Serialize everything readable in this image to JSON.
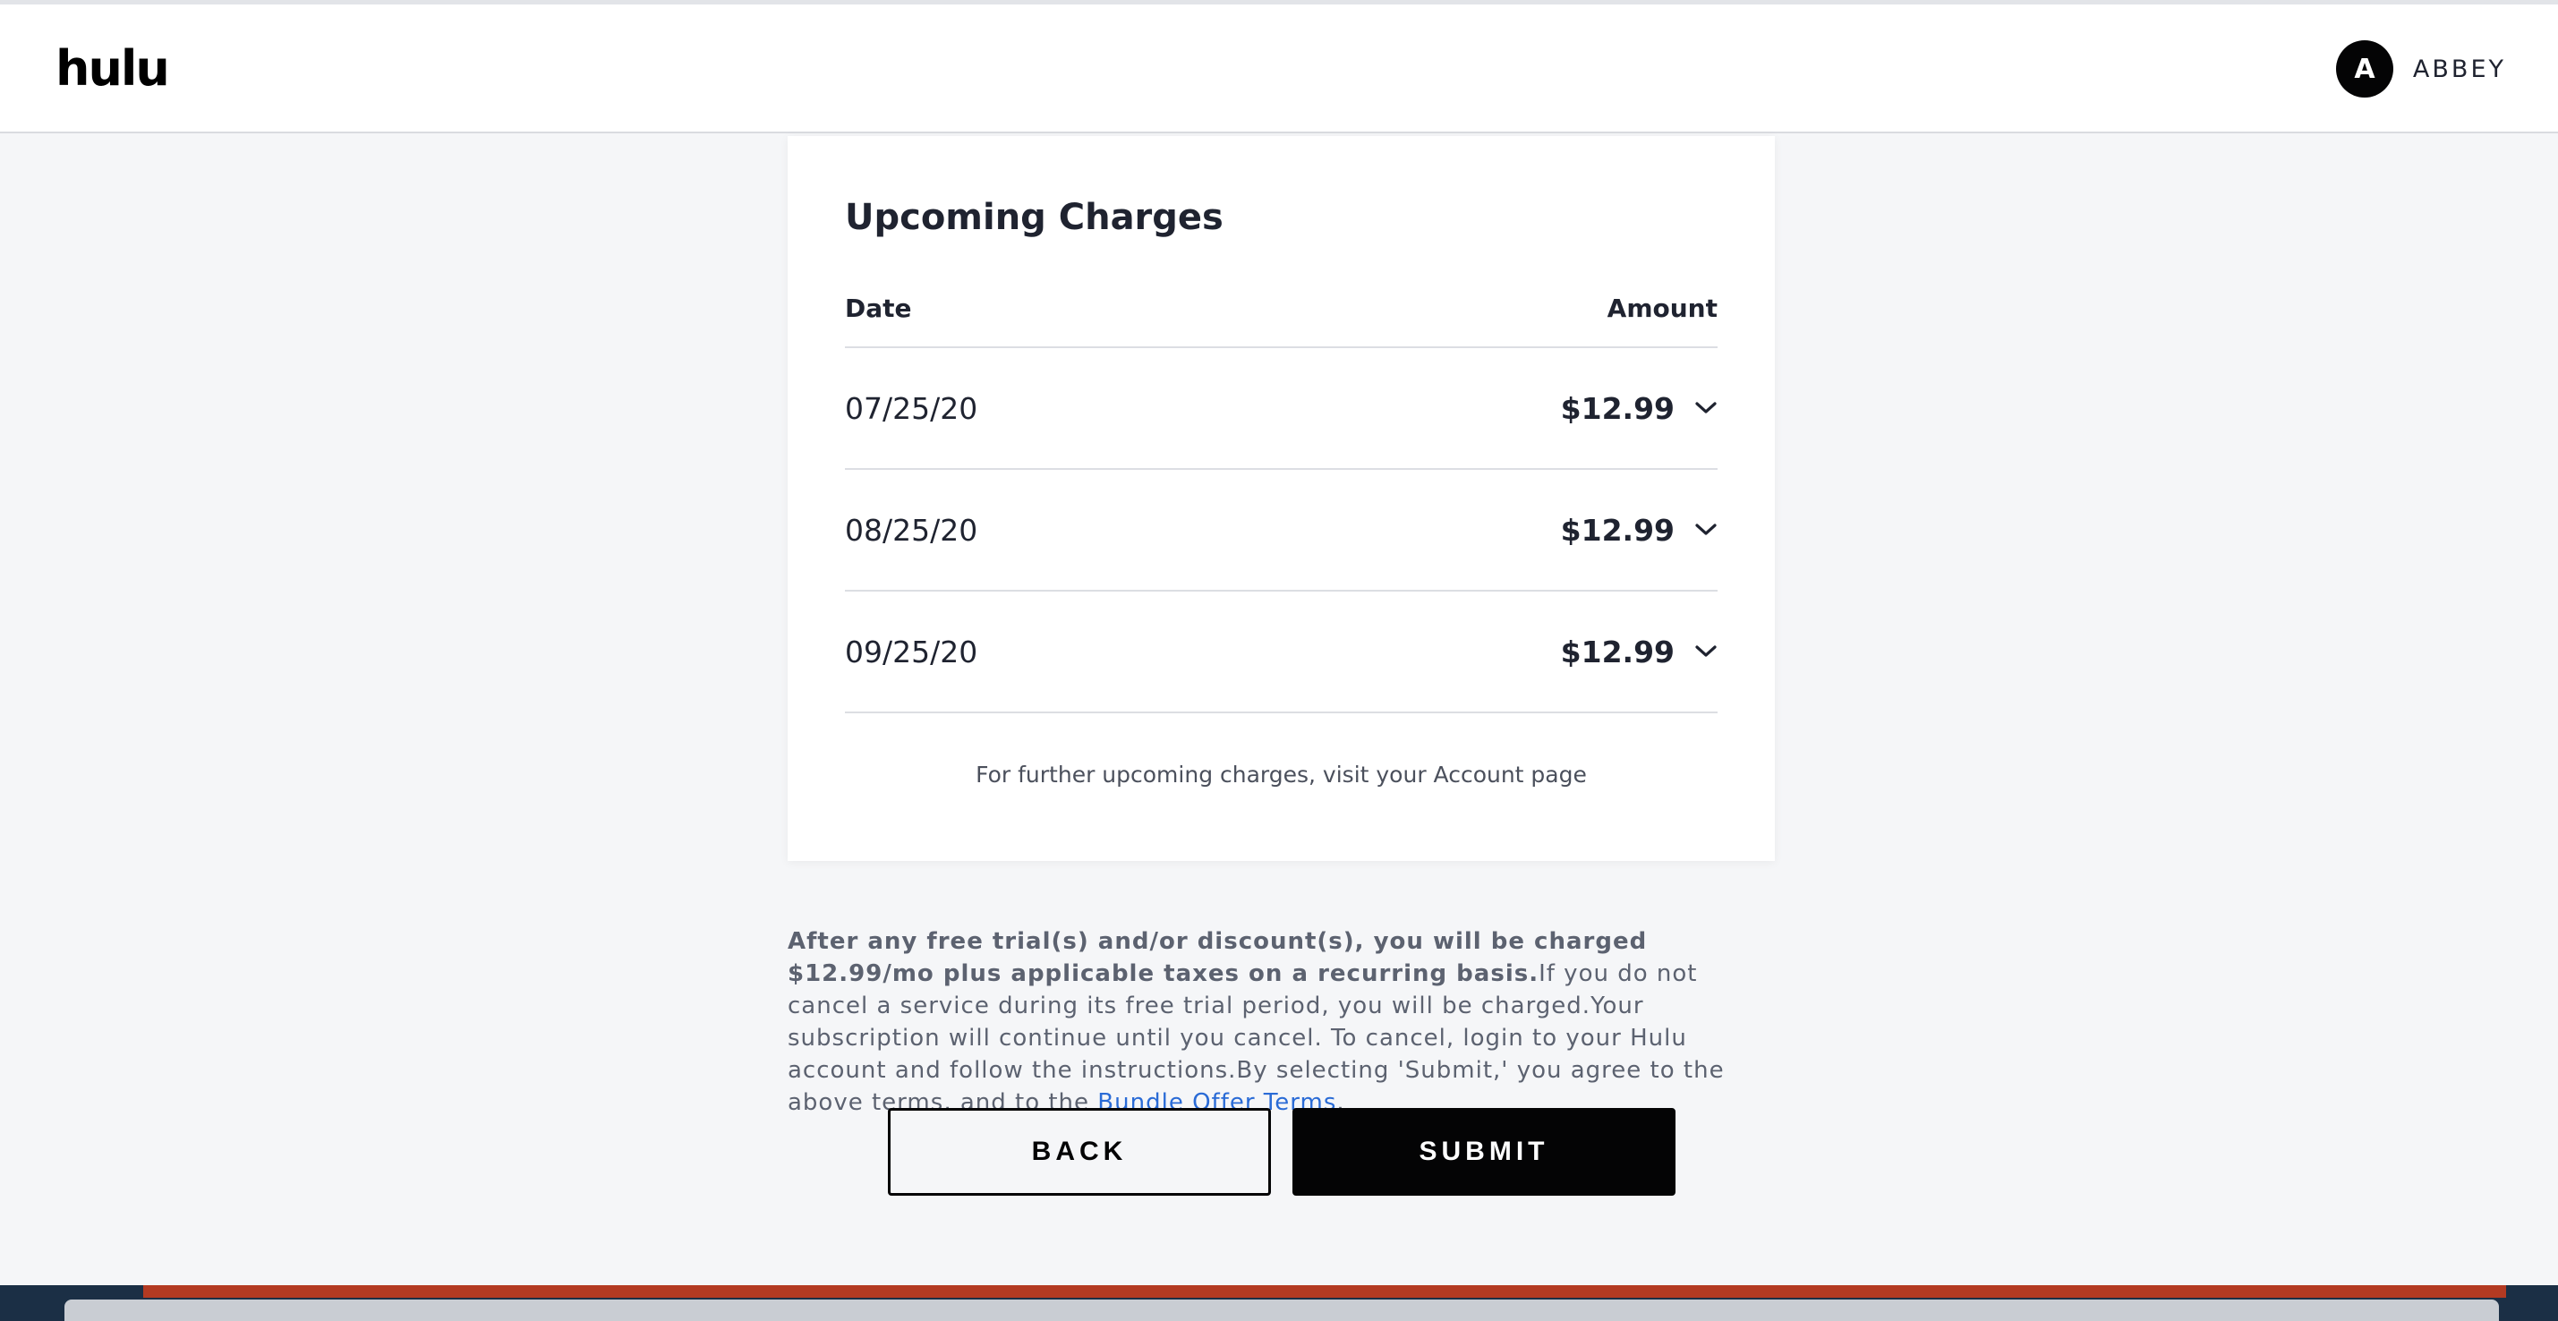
{
  "header": {
    "logo": "hulu",
    "profile_initial": "A",
    "profile_name": "ABBEY"
  },
  "charges": {
    "title": "Upcoming Charges",
    "columns": [
      "Date",
      "Amount"
    ],
    "rows": [
      {
        "date": "07/25/20",
        "amount": "$12.99"
      },
      {
        "date": "08/25/20",
        "amount": "$12.99"
      },
      {
        "date": "09/25/20",
        "amount": "$12.99"
      }
    ],
    "note": "For further upcoming charges, visit your Account page"
  },
  "terms": {
    "bold": "After any free trial(s) and/or discount(s), you will be charged $12.99/mo plus applicable taxes on a recurring basis.",
    "body": "If you do not cancel a service during its free trial period, you will be charged.Your subscription will continue until you cancel. To cancel, login to your Hulu account and follow the instructions.By selecting 'Submit,' you agree to the above terms, and to the ",
    "link": "Bundle Offer Terms",
    "end": "."
  },
  "buttons": {
    "back": "BACK",
    "submit": "SUBMIT"
  },
  "colors": {
    "link": "#2a6bd6",
    "primary": "#040405",
    "background": "#f5f6f8"
  }
}
